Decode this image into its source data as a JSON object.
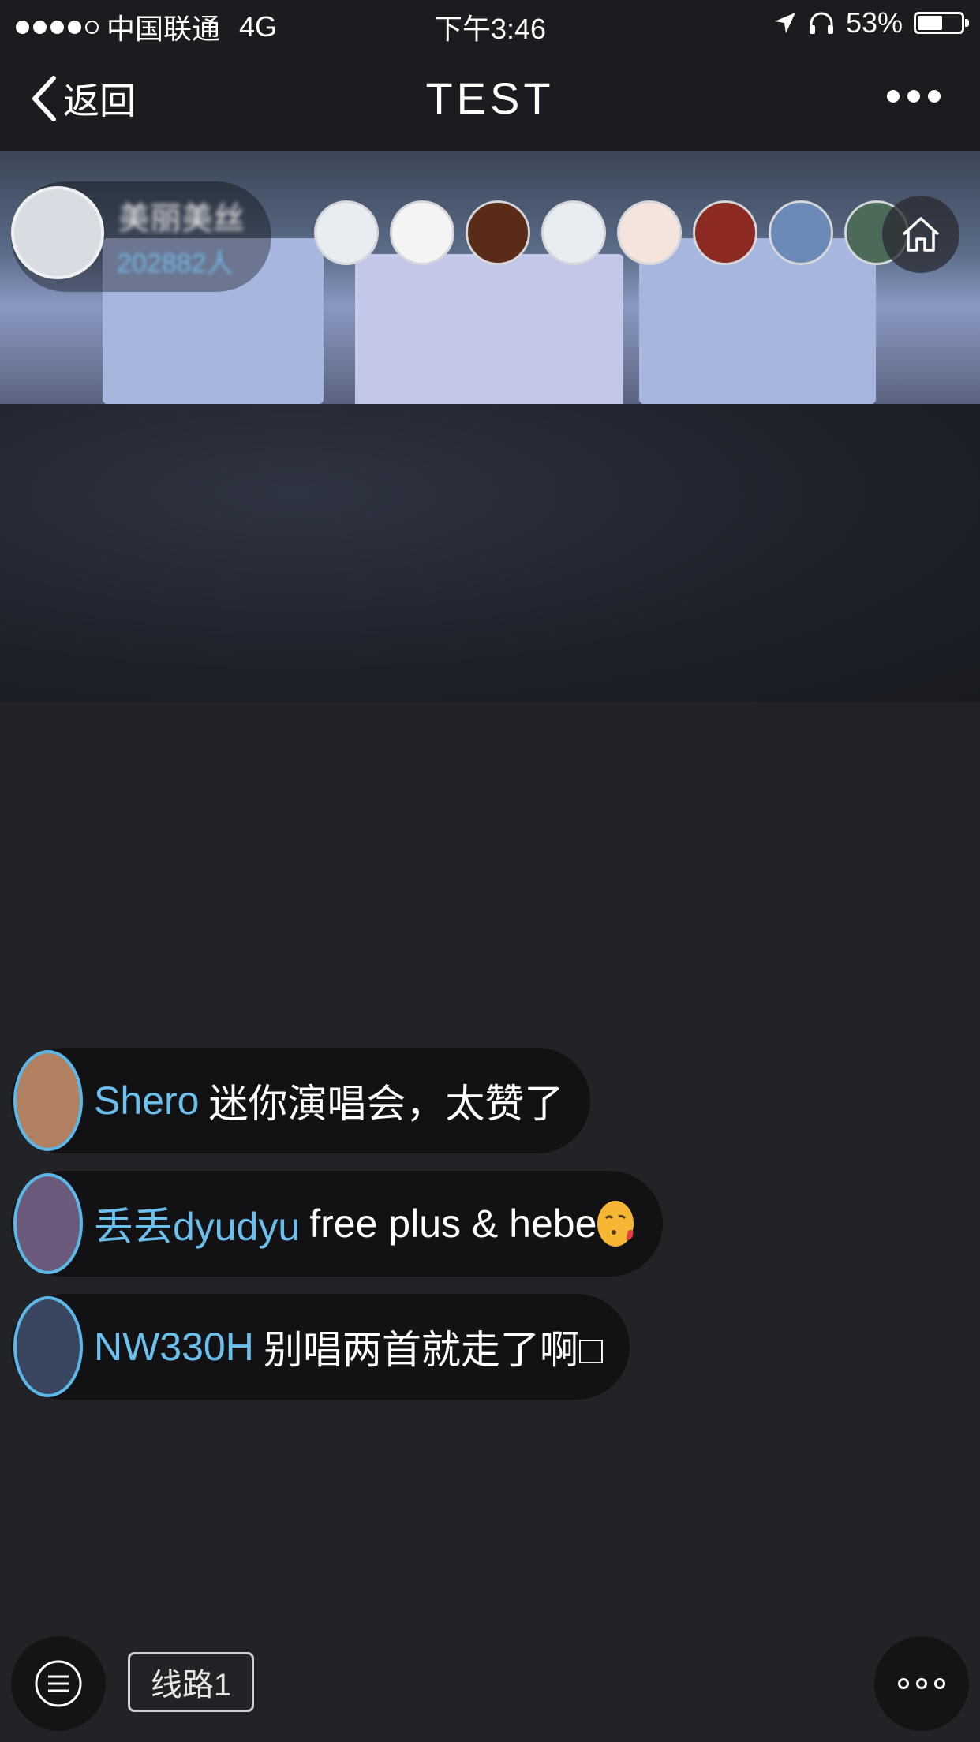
{
  "status_bar": {
    "carrier": "中国联通",
    "network": "4G",
    "time": "下午3:46",
    "battery_percent": "53%",
    "battery_level": 0.53,
    "icons": [
      "location-arrow-icon",
      "headphones-icon",
      "battery-icon"
    ]
  },
  "nav": {
    "back_label": "返回",
    "title": "TEST",
    "more_icon": "more-dots-icon"
  },
  "live": {
    "host_name": "美丽美丝",
    "viewer_count": "202882人",
    "viewer_avatar_colors": [
      "#e9edf2",
      "#f4f4f4",
      "#5a2c18",
      "#e9edf2",
      "#f5e3dd",
      "#8a2a20",
      "#6c8ab8",
      "#4c6a58"
    ],
    "home_icon": "home-icon"
  },
  "chat": [
    {
      "user": "Shero",
      "text": "迷你演唱会，太赞了",
      "avatar_color": "#b08060",
      "emoji": ""
    },
    {
      "user": "丢丢dyudyu",
      "text": "free plus & hebe",
      "avatar_color": "#6b5a7a",
      "emoji": "kiss-face"
    },
    {
      "user": "NW330H",
      "text": "别唱两首就走了啊□",
      "avatar_color": "#3a4660",
      "emoji": ""
    }
  ],
  "controls": {
    "route_label": "线路1",
    "menu_icon": "chat-list-icon",
    "more_icon": "more-circles-icon"
  }
}
